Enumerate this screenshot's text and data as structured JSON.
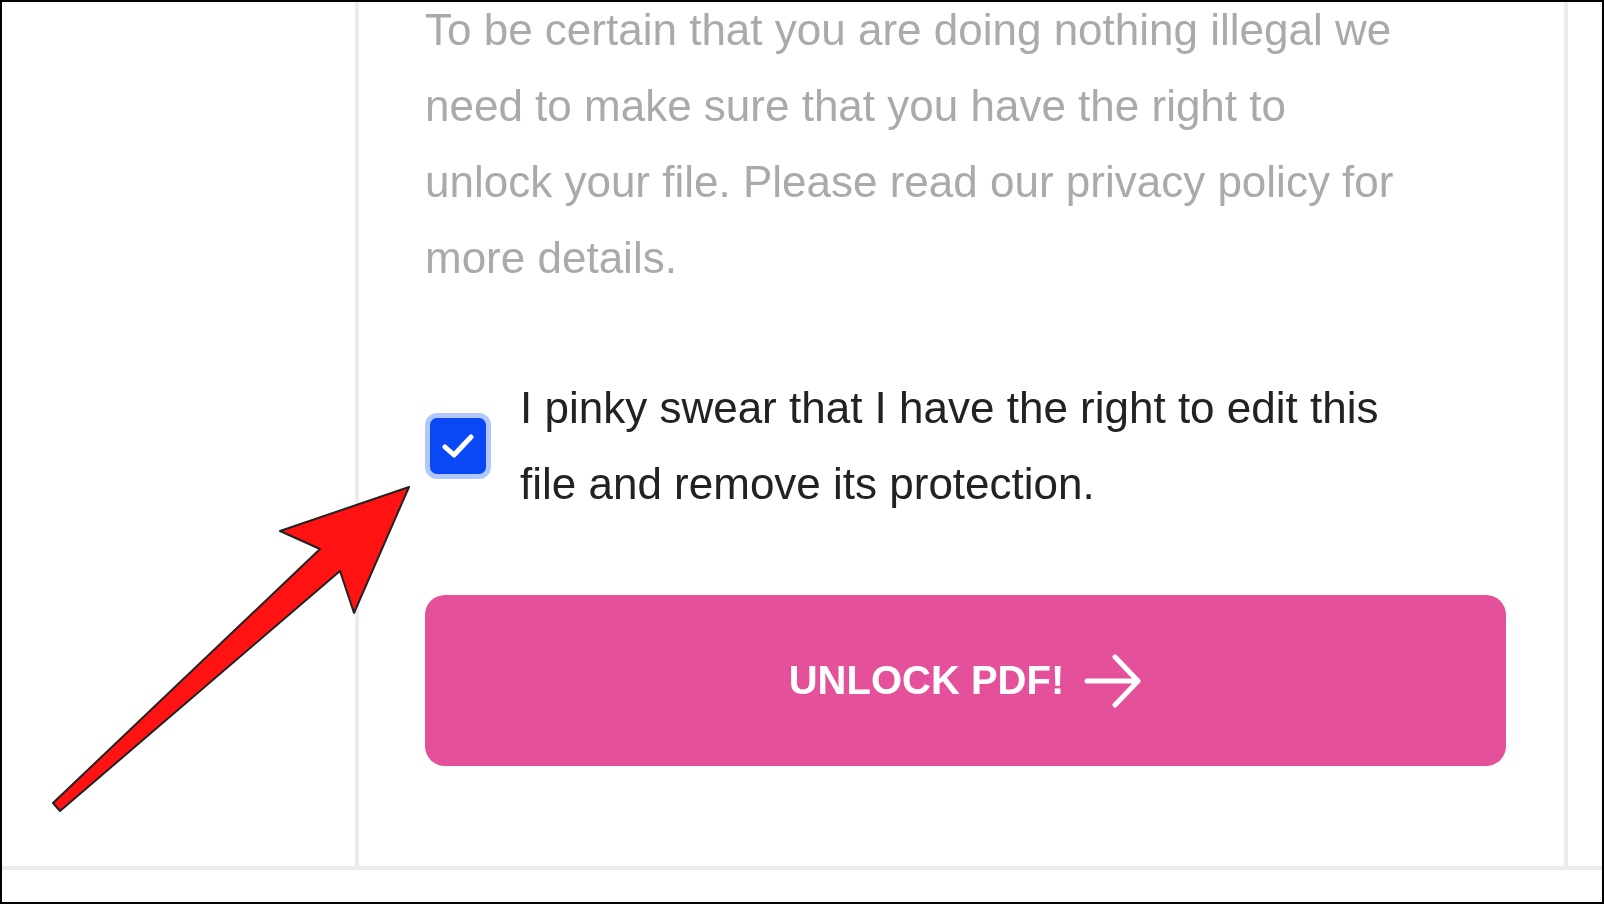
{
  "notice": {
    "text": "To be certain that you are doing nothing illegal we need to make sure that you have the right to unlock your file. Please read our privacy policy for more details."
  },
  "consent": {
    "label": "I pinky swear that I have the right to edit this file and remove its protection.",
    "checked": true
  },
  "unlock_button": {
    "label": "UNLOCK PDF!"
  }
}
